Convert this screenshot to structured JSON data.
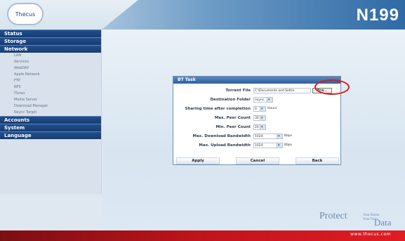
{
  "header": {
    "logo_text": "Thecus",
    "model": "N199"
  },
  "nav": {
    "main": [
      "Status",
      "Storage",
      "Network",
      "Accounts",
      "System",
      "Language"
    ],
    "network_sub": [
      "LAN",
      "Services",
      "WebDAV",
      "Apple Network",
      "FTP",
      "NFS",
      "iTunes",
      "Media Server",
      "Download Manager",
      "Nsync Target"
    ]
  },
  "panel": {
    "title": "BT Task",
    "rows": [
      {
        "label": "Torrent File",
        "value": "C:\\Documents and Settin",
        "button": "Brw..."
      },
      {
        "label": "Destination Folder",
        "value": "nsync"
      },
      {
        "label": "Sharing time after completion",
        "value": "0",
        "suffix": "Hours"
      },
      {
        "label": "Max. Peer Count",
        "value": "30"
      },
      {
        "label": "Min. Peer Count",
        "value": "20"
      },
      {
        "label": "Max. Download Bandwidth",
        "value": "1024",
        "suffix": "Kbps"
      },
      {
        "label": "Max. Upload Bandwidth",
        "value": "1024",
        "suffix": "Kbps"
      }
    ],
    "buttons": {
      "apply": "Apply",
      "cancel": "Cancel",
      "back": "Back"
    }
  },
  "footer": {
    "url": "www.thecus.com",
    "brand": {
      "word1": "Protect",
      "line1": "Your Home",
      "line2": "Your Own",
      "word2": "Data"
    }
  }
}
